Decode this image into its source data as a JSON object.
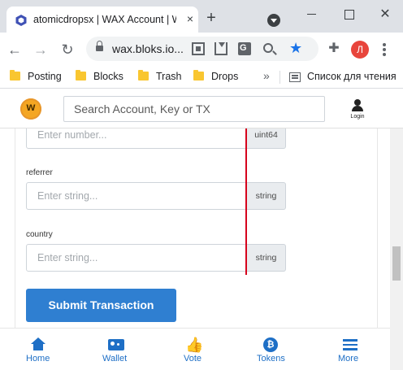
{
  "browser": {
    "tab_title": "atomicdropsx | WAX Account | W",
    "tab_close": "×",
    "new_tab": "+",
    "window_close": "✕",
    "url": "wax.bloks.io...",
    "profile_initial": "Л",
    "bookmarks": [
      {
        "label": "Posting"
      },
      {
        "label": "Blocks"
      },
      {
        "label": "Trash"
      },
      {
        "label": "Drops"
      }
    ],
    "bookmarks_more": "»",
    "reading_list": "Список для чтения"
  },
  "site": {
    "search_placeholder": "Search Account, Key or TX",
    "login_label": "Login"
  },
  "form": {
    "fields": [
      {
        "placeholder": "Enter number...",
        "type": "uint64"
      },
      {
        "label": "referrer",
        "placeholder": "Enter string...",
        "type": "string"
      },
      {
        "label": "country",
        "placeholder": "Enter string...",
        "type": "string"
      }
    ],
    "submit_label": "Submit Transaction"
  },
  "bottom_nav": [
    {
      "label": "Home",
      "icon": "home-icon"
    },
    {
      "label": "Wallet",
      "icon": "wallet-icon"
    },
    {
      "label": "Vote",
      "icon": "thumbs-up-icon"
    },
    {
      "label": "Tokens",
      "icon": "bitcoin-icon",
      "glyph": "₿"
    },
    {
      "label": "More",
      "icon": "hamburger-icon"
    }
  ],
  "colors": {
    "accent": "#2f7fd1",
    "nav_blue": "#1e6fc6",
    "annotation_red": "#d6001c",
    "wax_logo": "#f4a623"
  }
}
